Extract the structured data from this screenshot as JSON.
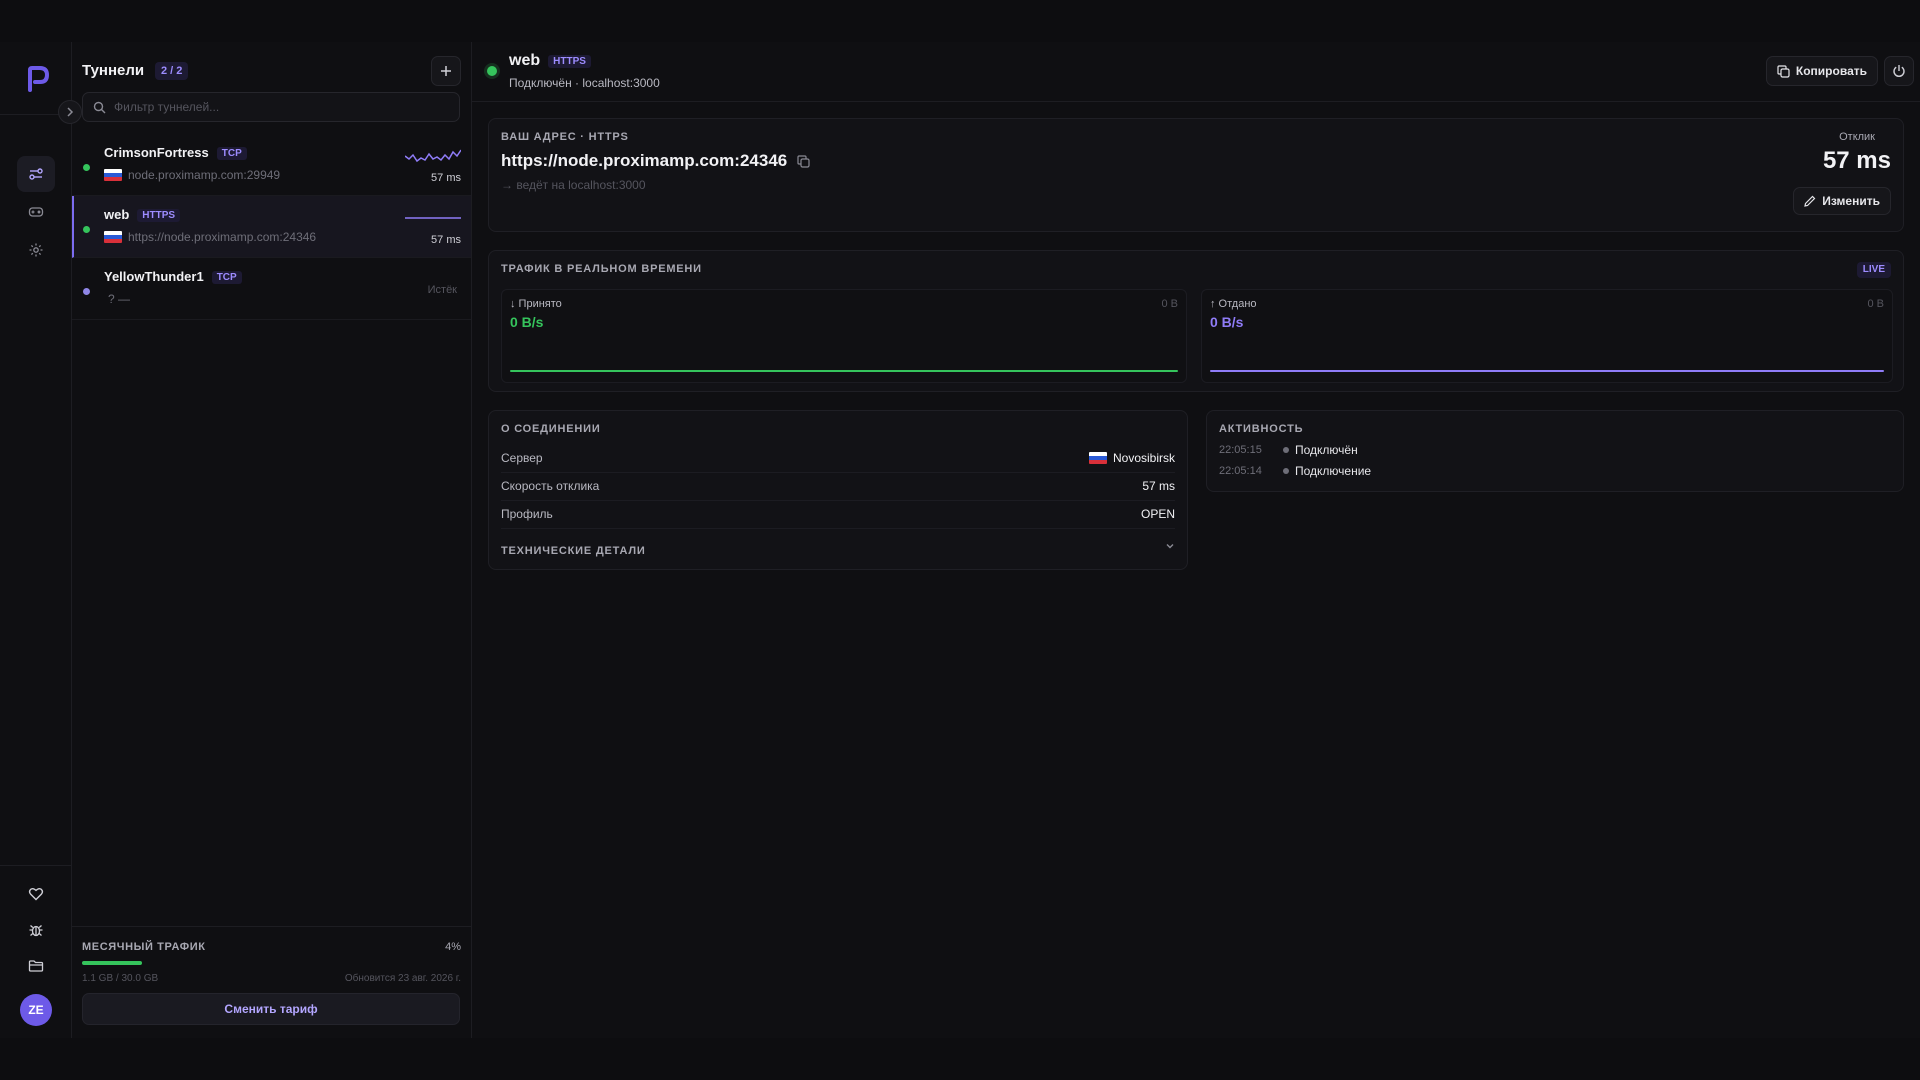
{
  "sidebar": {
    "logo_letter": "P",
    "avatar_initials": "ZE"
  },
  "tunnels_panel": {
    "title": "Туннели",
    "count": "2 / 2",
    "filter_placeholder": "Фильтр туннелей...",
    "tunnels": [
      {
        "name": "CrimsonFortress",
        "protocol": "TCP",
        "address": "node.proximamp.com:29949",
        "latency": "57 ms",
        "status_color": "#35c45c",
        "flag": "RU"
      },
      {
        "name": "web",
        "protocol": "HTTPS",
        "address": "https://node.proximamp.com:24346",
        "latency": "57 ms",
        "status_color": "#35c45c",
        "flag": "RU"
      },
      {
        "name": "YellowThunder1",
        "protocol": "TCP",
        "address": "? —",
        "state": "Истёк",
        "status_color": "#8f86e6"
      }
    ]
  },
  "monthly_traffic": {
    "label": "МЕСЯЧНЫЙ ТРАФИК",
    "percent": "4%",
    "fraction": 0.04,
    "used": "1.1 GB / 30.0 GB",
    "renews": "Обновится 23 авг. 2026 г.",
    "change_plan": "Сменить тариф"
  },
  "header": {
    "name": "web",
    "protocol": "HTTPS",
    "status": "Подключён · localhost:3000",
    "copy_label": "Копировать"
  },
  "address_card": {
    "caption": "ВАШ АДРЕС · HTTPS",
    "url": "https://node.proximamp.com:24346",
    "forward": "→ ведёт на localhost:3000",
    "latency_label": "Отклик",
    "latency_value": "57 ms",
    "edit_label": "Изменить"
  },
  "traffic_card": {
    "caption": "ТРАФИК В РЕАЛЬНОМ ВРЕМЕНИ",
    "live": "LIVE",
    "received": {
      "label": "↓ Принято",
      "total": "0 B",
      "rate": "0 B/s",
      "color": "#35c45c"
    },
    "sent": {
      "label": "↑ Отдано",
      "total": "0 B",
      "rate": "0 B/s",
      "color": "#8f7cf7"
    }
  },
  "connection_card": {
    "caption": "О СОЕДИНЕНИИ",
    "rows": [
      {
        "key": "Сервер",
        "value": "Novosibirsk"
      },
      {
        "key": "Скорость отклика",
        "value": "57 ms"
      },
      {
        "key": "Профиль",
        "value": "OPEN"
      }
    ],
    "tech_details": "ТЕХНИЧЕСКИЕ ДЕТАЛИ"
  },
  "activity_card": {
    "caption": "АКТИВНОСТЬ",
    "events": [
      {
        "time": "22:05:15",
        "message": "Подключён"
      },
      {
        "time": "22:05:14",
        "message": "Подключение"
      }
    ]
  },
  "colors": {
    "accent": "#7c6cf0",
    "online": "#35c45c",
    "background": "#0f0f12"
  }
}
